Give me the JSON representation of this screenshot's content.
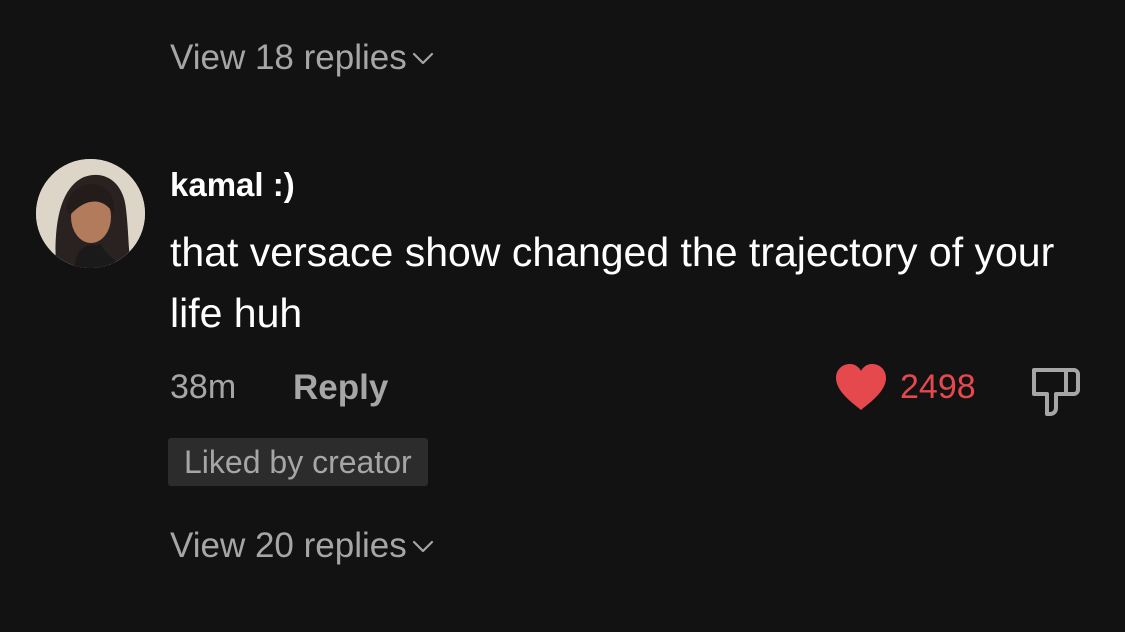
{
  "replies_top": {
    "label": "View 18 replies"
  },
  "comment": {
    "username": "kamal :)",
    "text": "that versace show changed the trajectory of your life huh",
    "time": "38m",
    "reply_label": "Reply",
    "like_count": "2498",
    "badge": "Liked by creator"
  },
  "replies_bottom": {
    "label": "View 20 replies"
  },
  "colors": {
    "background": "#121212",
    "heart": "#e5484d",
    "muted_text": "#a6a6a6",
    "badge_bg": "#2c2c2c"
  },
  "icons": [
    "chevron-down-icon",
    "heart-icon",
    "thumbs-down-icon",
    "avatar"
  ]
}
